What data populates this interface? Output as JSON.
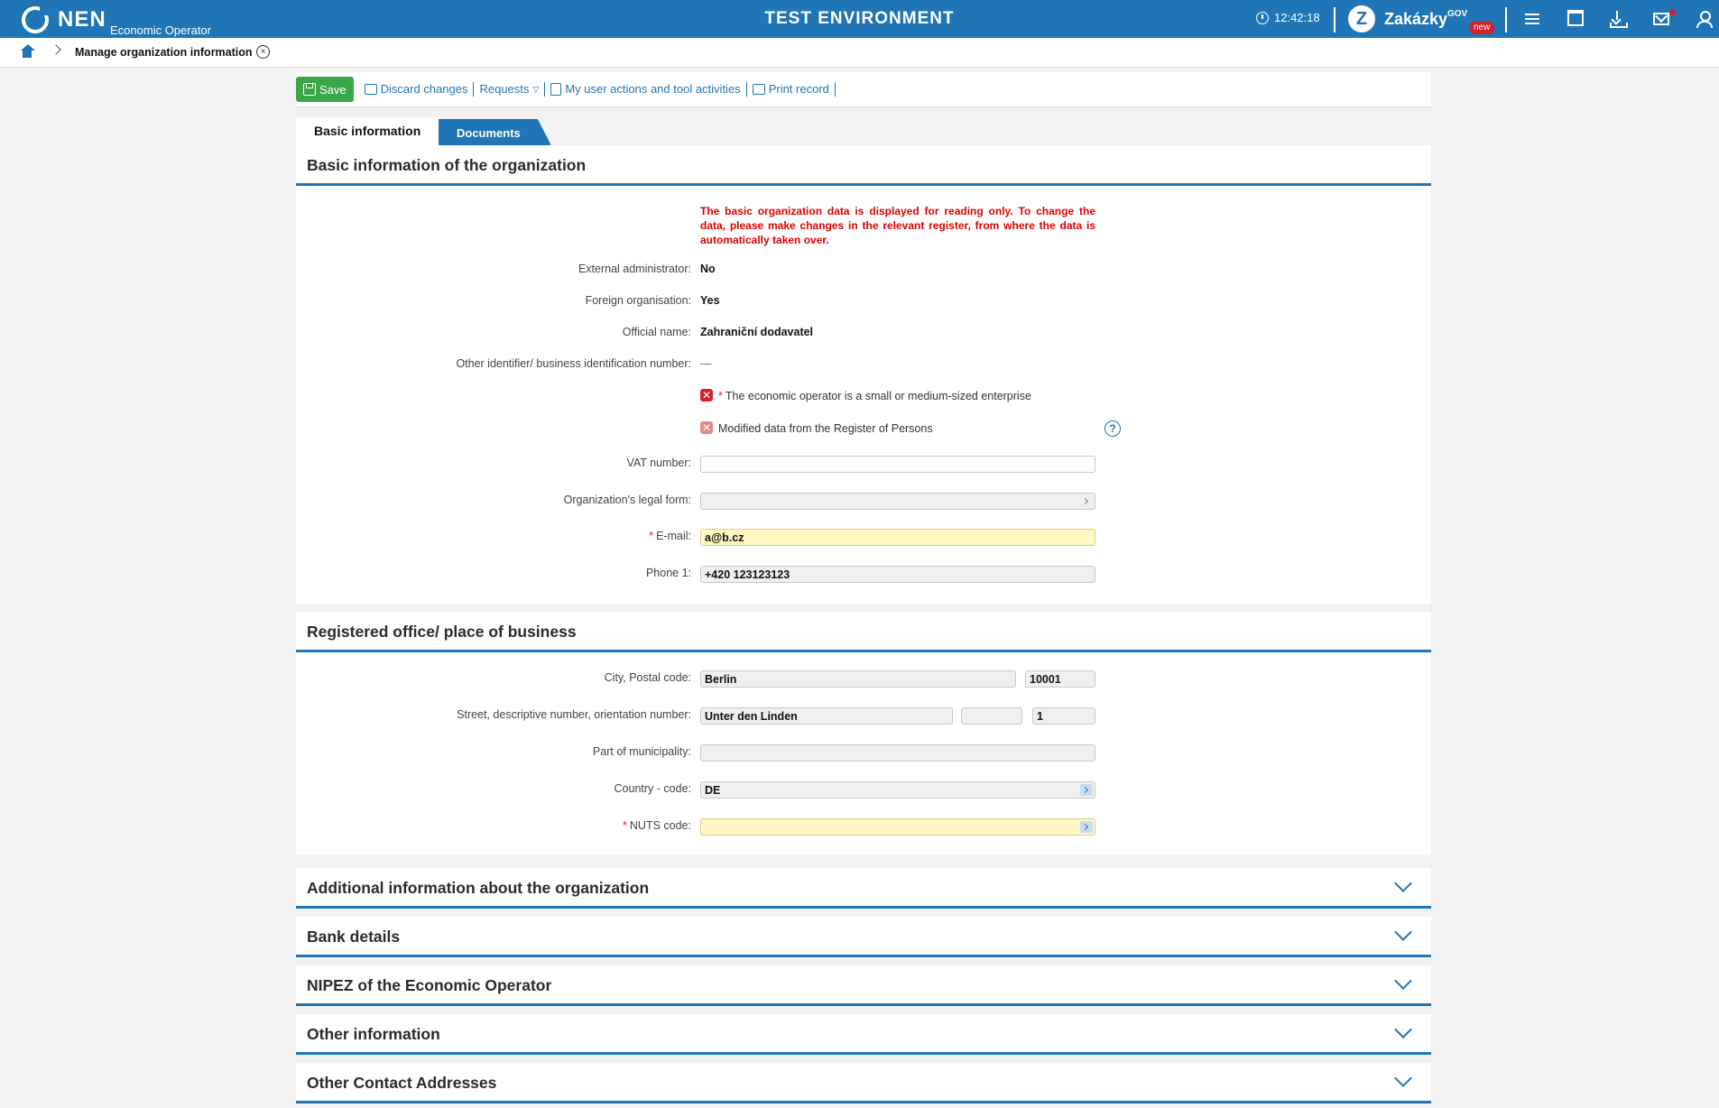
{
  "header": {
    "logo_text": "NEN",
    "logo_subtitle": "Economic Operator",
    "environment": "TEST ENVIRONMENT",
    "time": "12:42:18",
    "zakazky": "Zakázky",
    "zakazky_sup": "GOV",
    "zakazky_badge": "new"
  },
  "breadcrumb": {
    "current": "Manage organization information"
  },
  "toolbar": {
    "save": "Save",
    "discard": "Discard changes",
    "requests": "Requests",
    "actions": "My user actions and tool activities",
    "print": "Print record"
  },
  "tabs": {
    "basic": "Basic information",
    "documents": "Documents"
  },
  "basic": {
    "title": "Basic information of the organization",
    "warning": "The basic organization data is displayed for reading only. To change the data, please make changes in the relevant register, from where the data is automatically taken over.",
    "external_admin_label": "External administrator:",
    "external_admin_value": "No",
    "foreign_label": "Foreign organisation:",
    "foreign_value": "Yes",
    "official_name_label": "Official name:",
    "official_name_value": "Zahraniční dodavatel",
    "other_id_label": "Other identifier/ business identification number:",
    "other_id_value": "—",
    "sme_label": "The economic operator is a small or medium-sized enterprise",
    "modified_label": "Modified data from the Register of Persons",
    "vat_label": "VAT number:",
    "vat_value": "",
    "legal_form_label": "Organization's legal form:",
    "legal_form_value": "",
    "email_label": "E-mail:",
    "email_value": "a@b.cz",
    "phone_label": "Phone 1:",
    "phone_value": "+420 123123123"
  },
  "office": {
    "title": "Registered office/ place of business",
    "city_label": "City, Postal code:",
    "city_value": "Berlin",
    "postal_value": "10001",
    "street_label": "Street, descriptive number, orientation number:",
    "street_value": "Unter den Linden",
    "descriptive_value": "",
    "orientation_value": "1",
    "part_label": "Part of municipality:",
    "part_value": "",
    "country_label": "Country - code:",
    "country_value": "DE",
    "nuts_label": "NUTS code:",
    "nuts_value": ""
  },
  "collapsed_sections": [
    "Additional information about the organization",
    "Bank details",
    "NIPEZ of the Economic Operator",
    "Other information",
    "Other Contact Addresses"
  ]
}
